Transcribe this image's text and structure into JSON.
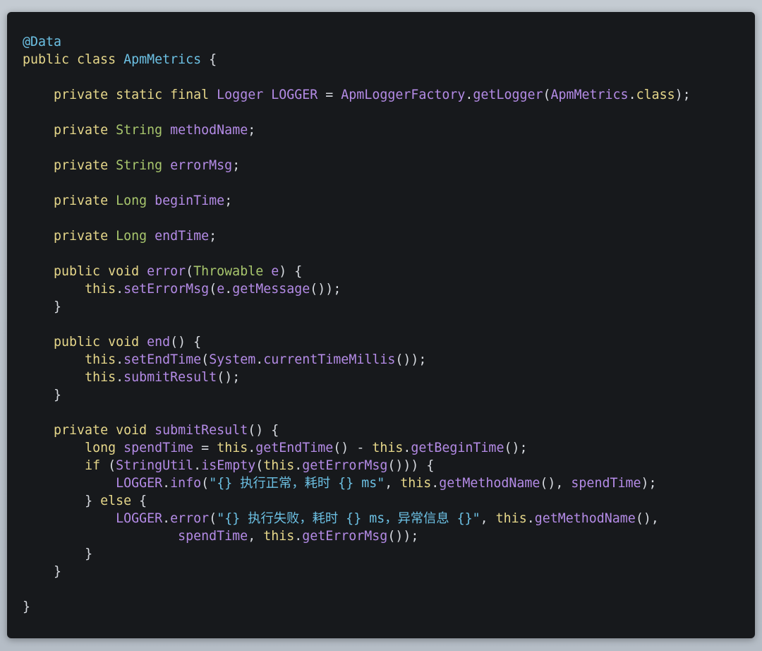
{
  "code": {
    "lines": [
      [
        [
          "ann",
          "@Data"
        ]
      ],
      [
        [
          "kw",
          "public class "
        ],
        [
          "cls",
          "ApmMetrics"
        ],
        [
          "pun",
          " {"
        ]
      ],
      [],
      [
        [
          "plain",
          "    "
        ],
        [
          "kw",
          "private static final "
        ],
        [
          "id",
          "Logger LOGGER"
        ],
        [
          "pun",
          " = "
        ],
        [
          "id",
          "ApmLoggerFactory"
        ],
        [
          "pun",
          "."
        ],
        [
          "fn",
          "getLogger"
        ],
        [
          "pun",
          "("
        ],
        [
          "id",
          "ApmMetrics"
        ],
        [
          "pun",
          "."
        ],
        [
          "kw",
          "class"
        ],
        [
          "pun",
          ");"
        ]
      ],
      [],
      [
        [
          "plain",
          "    "
        ],
        [
          "kw",
          "private "
        ],
        [
          "type",
          "String "
        ],
        [
          "id",
          "methodName"
        ],
        [
          "pun",
          ";"
        ]
      ],
      [],
      [
        [
          "plain",
          "    "
        ],
        [
          "kw",
          "private "
        ],
        [
          "type",
          "String "
        ],
        [
          "id",
          "errorMsg"
        ],
        [
          "pun",
          ";"
        ]
      ],
      [],
      [
        [
          "plain",
          "    "
        ],
        [
          "kw",
          "private "
        ],
        [
          "type",
          "Long "
        ],
        [
          "id",
          "beginTime"
        ],
        [
          "pun",
          ";"
        ]
      ],
      [],
      [
        [
          "plain",
          "    "
        ],
        [
          "kw",
          "private "
        ],
        [
          "type",
          "Long "
        ],
        [
          "id",
          "endTime"
        ],
        [
          "pun",
          ";"
        ]
      ],
      [],
      [
        [
          "plain",
          "    "
        ],
        [
          "kw",
          "public void "
        ],
        [
          "fn",
          "error"
        ],
        [
          "pun",
          "("
        ],
        [
          "type",
          "Throwable "
        ],
        [
          "id",
          "e"
        ],
        [
          "pun",
          ") {"
        ]
      ],
      [
        [
          "plain",
          "        "
        ],
        [
          "kw",
          "this"
        ],
        [
          "pun",
          "."
        ],
        [
          "fn",
          "setErrorMsg"
        ],
        [
          "pun",
          "("
        ],
        [
          "id",
          "e"
        ],
        [
          "pun",
          "."
        ],
        [
          "fn",
          "getMessage"
        ],
        [
          "pun",
          "());"
        ]
      ],
      [
        [
          "plain",
          "    "
        ],
        [
          "pun",
          "}"
        ]
      ],
      [],
      [
        [
          "plain",
          "    "
        ],
        [
          "kw",
          "public void "
        ],
        [
          "fn",
          "end"
        ],
        [
          "pun",
          "() {"
        ]
      ],
      [
        [
          "plain",
          "        "
        ],
        [
          "kw",
          "this"
        ],
        [
          "pun",
          "."
        ],
        [
          "fn",
          "setEndTime"
        ],
        [
          "pun",
          "("
        ],
        [
          "id",
          "System"
        ],
        [
          "pun",
          "."
        ],
        [
          "fn",
          "currentTimeMillis"
        ],
        [
          "pun",
          "());"
        ]
      ],
      [
        [
          "plain",
          "        "
        ],
        [
          "kw",
          "this"
        ],
        [
          "pun",
          "."
        ],
        [
          "fn",
          "submitResult"
        ],
        [
          "pun",
          "();"
        ]
      ],
      [
        [
          "plain",
          "    "
        ],
        [
          "pun",
          "}"
        ]
      ],
      [],
      [
        [
          "plain",
          "    "
        ],
        [
          "kw",
          "private void "
        ],
        [
          "fn",
          "submitResult"
        ],
        [
          "pun",
          "() {"
        ]
      ],
      [
        [
          "plain",
          "        "
        ],
        [
          "kw",
          "long "
        ],
        [
          "id",
          "spendTime"
        ],
        [
          "pun",
          " = "
        ],
        [
          "kw",
          "this"
        ],
        [
          "pun",
          "."
        ],
        [
          "fn",
          "getEndTime"
        ],
        [
          "pun",
          "() - "
        ],
        [
          "kw",
          "this"
        ],
        [
          "pun",
          "."
        ],
        [
          "fn",
          "getBeginTime"
        ],
        [
          "pun",
          "();"
        ]
      ],
      [
        [
          "plain",
          "        "
        ],
        [
          "kw",
          "if "
        ],
        [
          "pun",
          "("
        ],
        [
          "id",
          "StringUtil"
        ],
        [
          "pun",
          "."
        ],
        [
          "fn",
          "isEmpty"
        ],
        [
          "pun",
          "("
        ],
        [
          "kw",
          "this"
        ],
        [
          "pun",
          "."
        ],
        [
          "fn",
          "getErrorMsg"
        ],
        [
          "pun",
          "())) {"
        ]
      ],
      [
        [
          "plain",
          "            "
        ],
        [
          "id",
          "LOGGER"
        ],
        [
          "pun",
          "."
        ],
        [
          "fn",
          "info"
        ],
        [
          "pun",
          "("
        ],
        [
          "str",
          "\"{} 执行正常，耗时 {} ms\""
        ],
        [
          "pun",
          ", "
        ],
        [
          "kw",
          "this"
        ],
        [
          "pun",
          "."
        ],
        [
          "fn",
          "getMethodName"
        ],
        [
          "pun",
          "(), "
        ],
        [
          "id",
          "spendTime"
        ],
        [
          "pun",
          ");"
        ]
      ],
      [
        [
          "plain",
          "        "
        ],
        [
          "pun",
          "} "
        ],
        [
          "kw",
          "else"
        ],
        [
          "pun",
          " {"
        ]
      ],
      [
        [
          "plain",
          "            "
        ],
        [
          "id",
          "LOGGER"
        ],
        [
          "pun",
          "."
        ],
        [
          "fn",
          "error"
        ],
        [
          "pun",
          "("
        ],
        [
          "str",
          "\"{} 执行失败，耗时 {} ms，异常信息 {}\""
        ],
        [
          "pun",
          ", "
        ],
        [
          "kw",
          "this"
        ],
        [
          "pun",
          "."
        ],
        [
          "fn",
          "getMethodName"
        ],
        [
          "pun",
          "(),"
        ]
      ],
      [
        [
          "plain",
          "                    "
        ],
        [
          "id",
          "spendTime"
        ],
        [
          "pun",
          ", "
        ],
        [
          "kw",
          "this"
        ],
        [
          "pun",
          "."
        ],
        [
          "fn",
          "getErrorMsg"
        ],
        [
          "pun",
          "());"
        ]
      ],
      [
        [
          "plain",
          "        "
        ],
        [
          "pun",
          "}"
        ]
      ],
      [
        [
          "plain",
          "    "
        ],
        [
          "pun",
          "}"
        ]
      ],
      [],
      [
        [
          "pun",
          "}"
        ]
      ]
    ]
  },
  "colors": {
    "background": "#17191c",
    "annotation": "#6cc0e3",
    "keyword": "#e6d78a",
    "type": "#a8c66d",
    "class": "#6cc0e3",
    "identifier": "#b48be6",
    "string": "#6cc0e3",
    "punctuation": "#d7dae0"
  }
}
